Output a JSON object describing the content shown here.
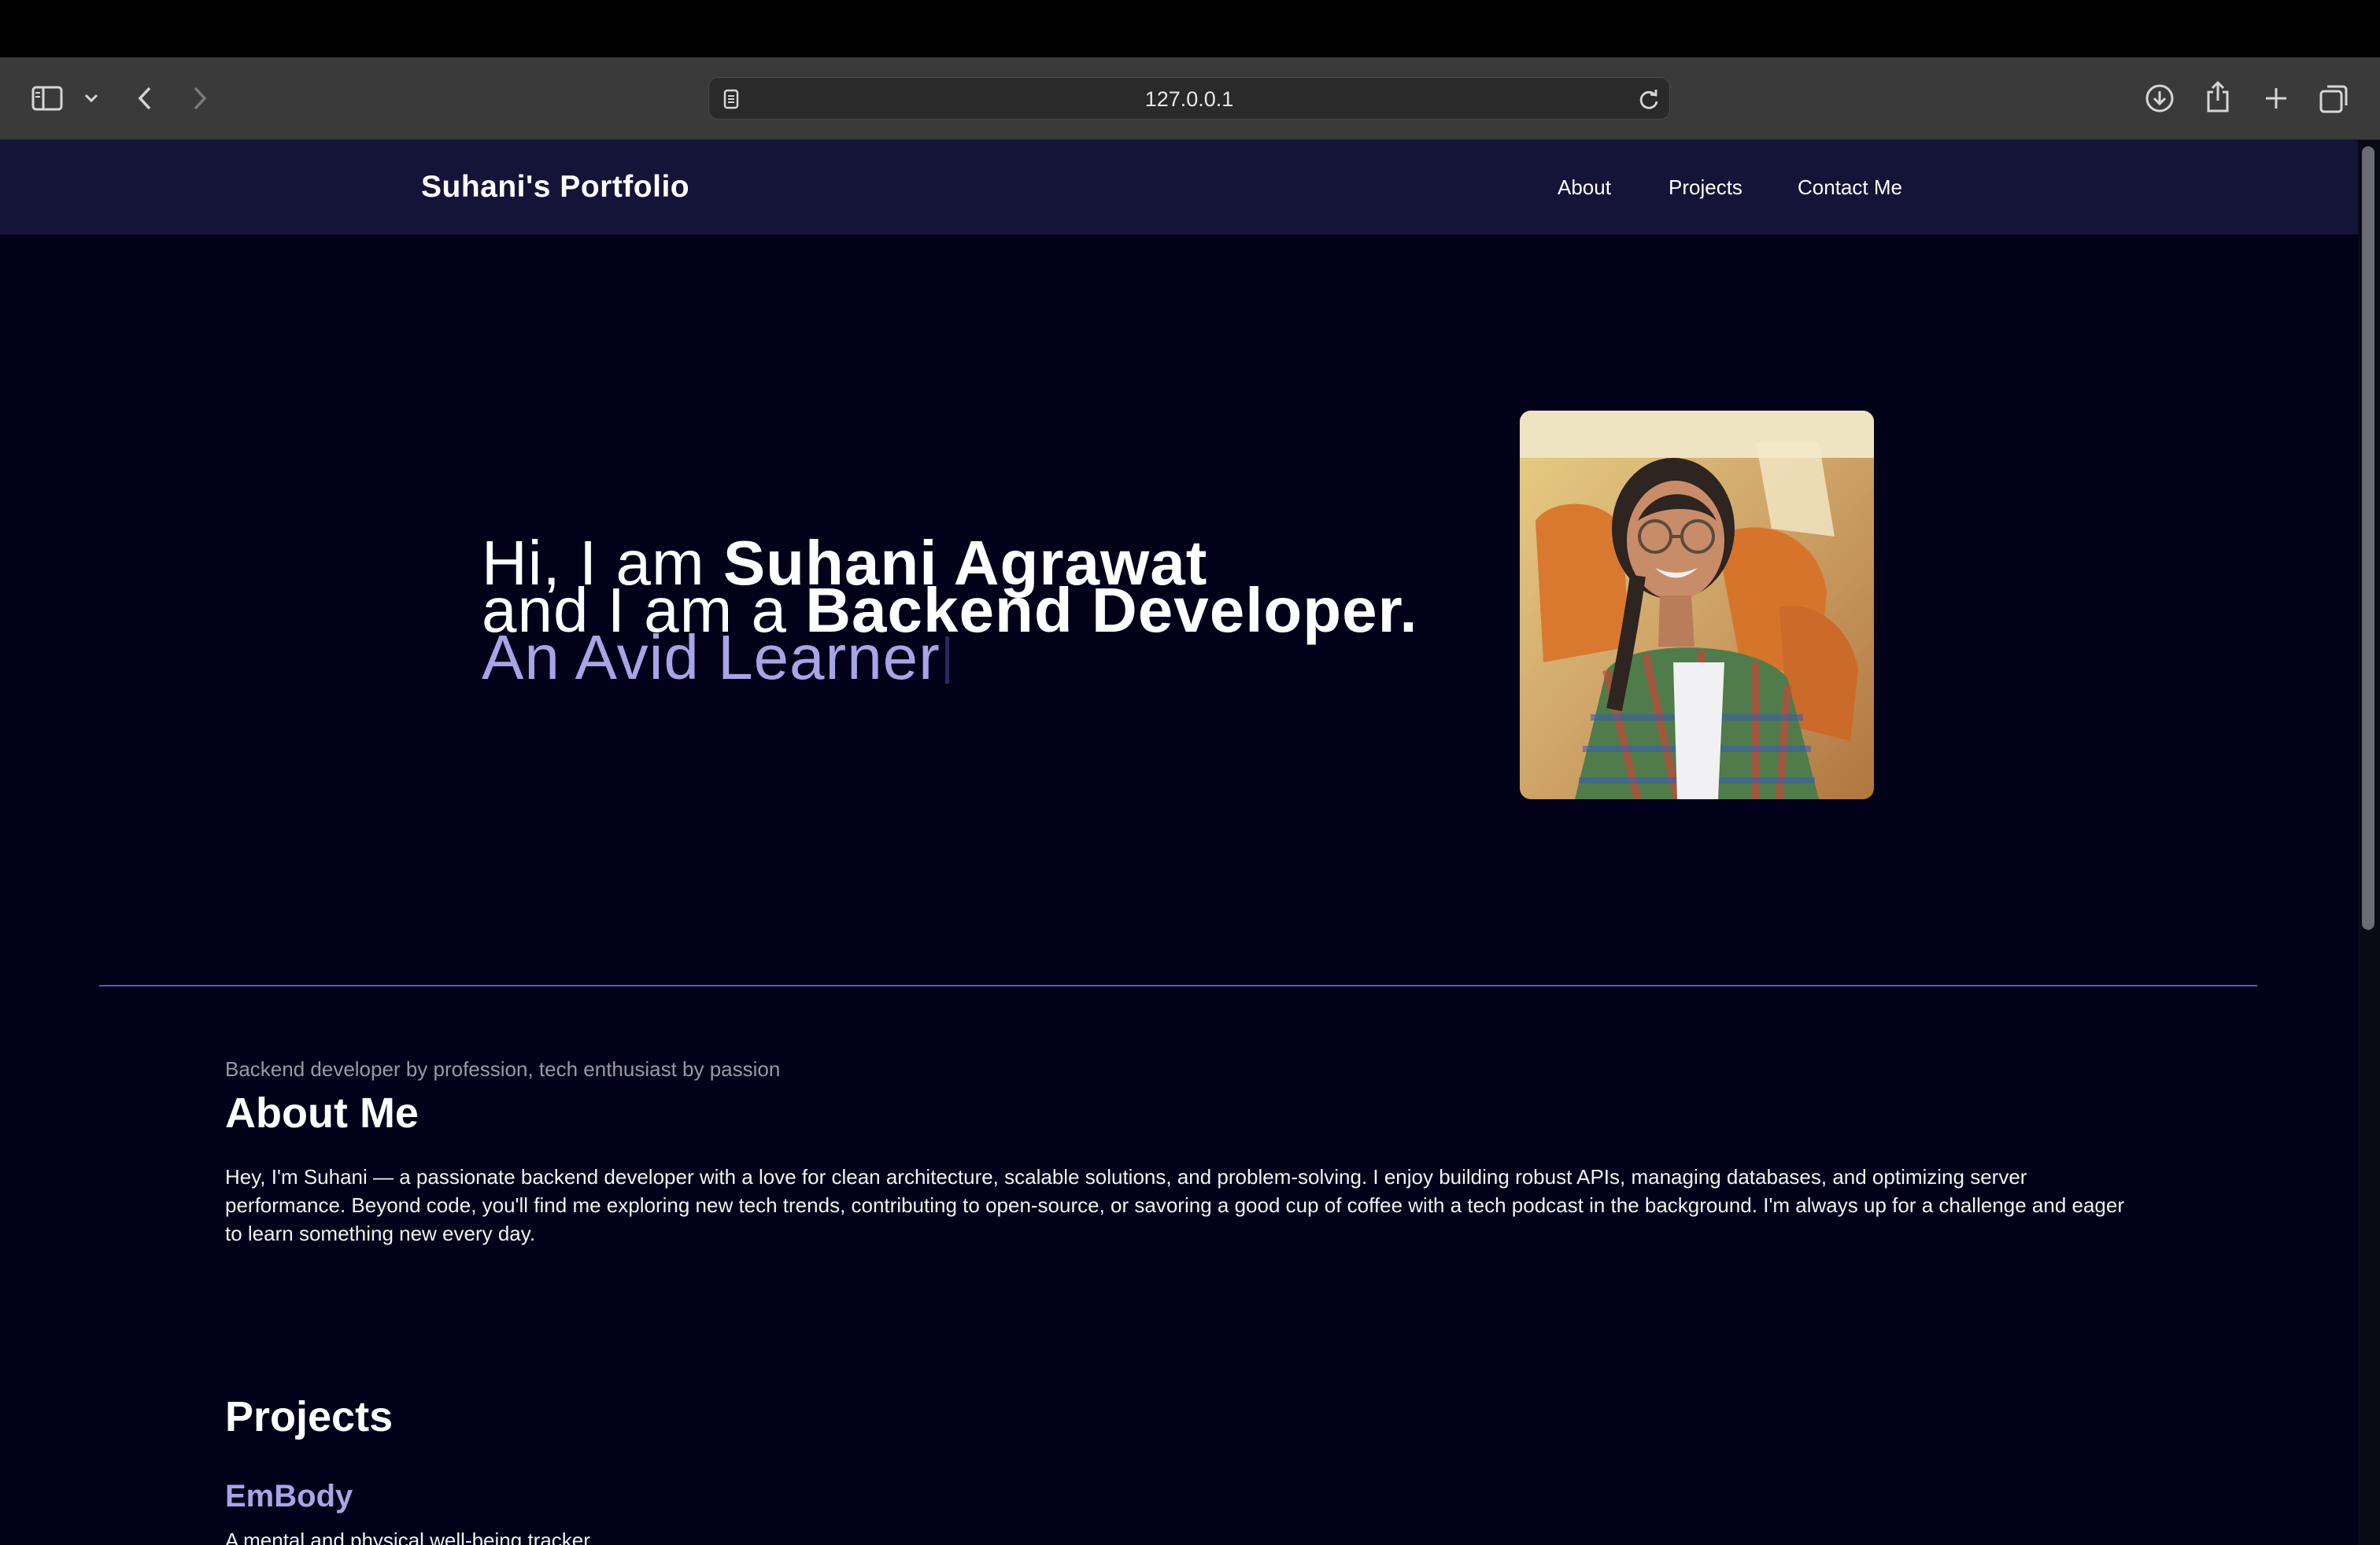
{
  "browser": {
    "url": "127.0.0.1",
    "icons": {
      "sidebar": "sidebar-icon",
      "sidebar_menu": "chevron-down-icon",
      "back": "chevron-left-icon",
      "forward": "chevron-right-icon",
      "page": "document-icon",
      "reload": "reload-icon",
      "downloads": "download-icon",
      "share": "share-icon",
      "new_tab": "plus-icon",
      "tabs": "tabs-overview-icon"
    }
  },
  "nav": {
    "brand": "Suhani's Portfolio",
    "links": [
      "About",
      "Projects",
      "Contact Me"
    ]
  },
  "hero": {
    "line1_prefix": "Hi, I am ",
    "line1_name": "Suhani Agrawat",
    "line2_prefix": "and I am a ",
    "line2_role": "Backend Developer.",
    "typed_text": "An Avid Learner"
  },
  "about": {
    "tagline": "Backend developer by profession, tech enthusiast by passion",
    "title": "About Me",
    "body": "Hey, I'm Suhani — a passionate backend developer with a love for clean architecture, scalable solutions, and problem-solving. I enjoy building robust APIs, managing databases, and optimizing server performance. Beyond code, you'll find me exploring new tech trends, contributing to open-source, or savoring a good cup of coffee with a tech podcast in the background. I'm always up for a challenge and eager to learn something new every day."
  },
  "projects": {
    "title": "Projects",
    "items": [
      {
        "name": "EmBody",
        "description": "A mental and physical well-being tracker"
      }
    ]
  },
  "colors": {
    "page_bg": "#020119",
    "nav_bg": "#141338",
    "accent": "#a9a4e6",
    "divider": "#5f5bb3"
  }
}
